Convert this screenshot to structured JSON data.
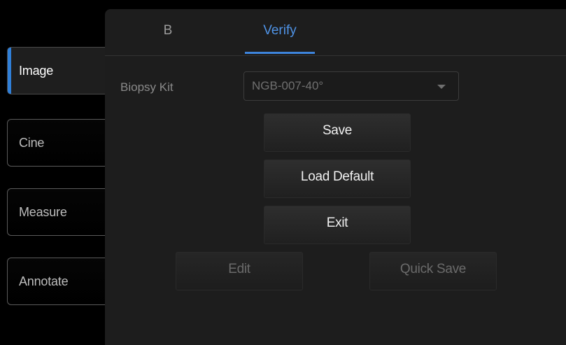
{
  "sidebar": {
    "items": [
      {
        "label": "Image",
        "active": true
      },
      {
        "label": "Cine",
        "active": false
      },
      {
        "label": "Measure",
        "active": false
      },
      {
        "label": "Annotate",
        "active": false
      }
    ]
  },
  "tabs": [
    {
      "label": "B",
      "active": false
    },
    {
      "label": "Verify",
      "active": true
    }
  ],
  "biopsy_kit": {
    "label": "Biopsy Kit",
    "value": "NGB-007-40°",
    "enabled": false
  },
  "buttons": {
    "save": "Save",
    "load_default": "Load Default",
    "exit": "Exit",
    "edit": "Edit",
    "quick_save": "Quick Save"
  },
  "colors": {
    "accent": "#3d84dc",
    "panel_bg": "#1d1d1d",
    "page_bg": "#000000"
  }
}
